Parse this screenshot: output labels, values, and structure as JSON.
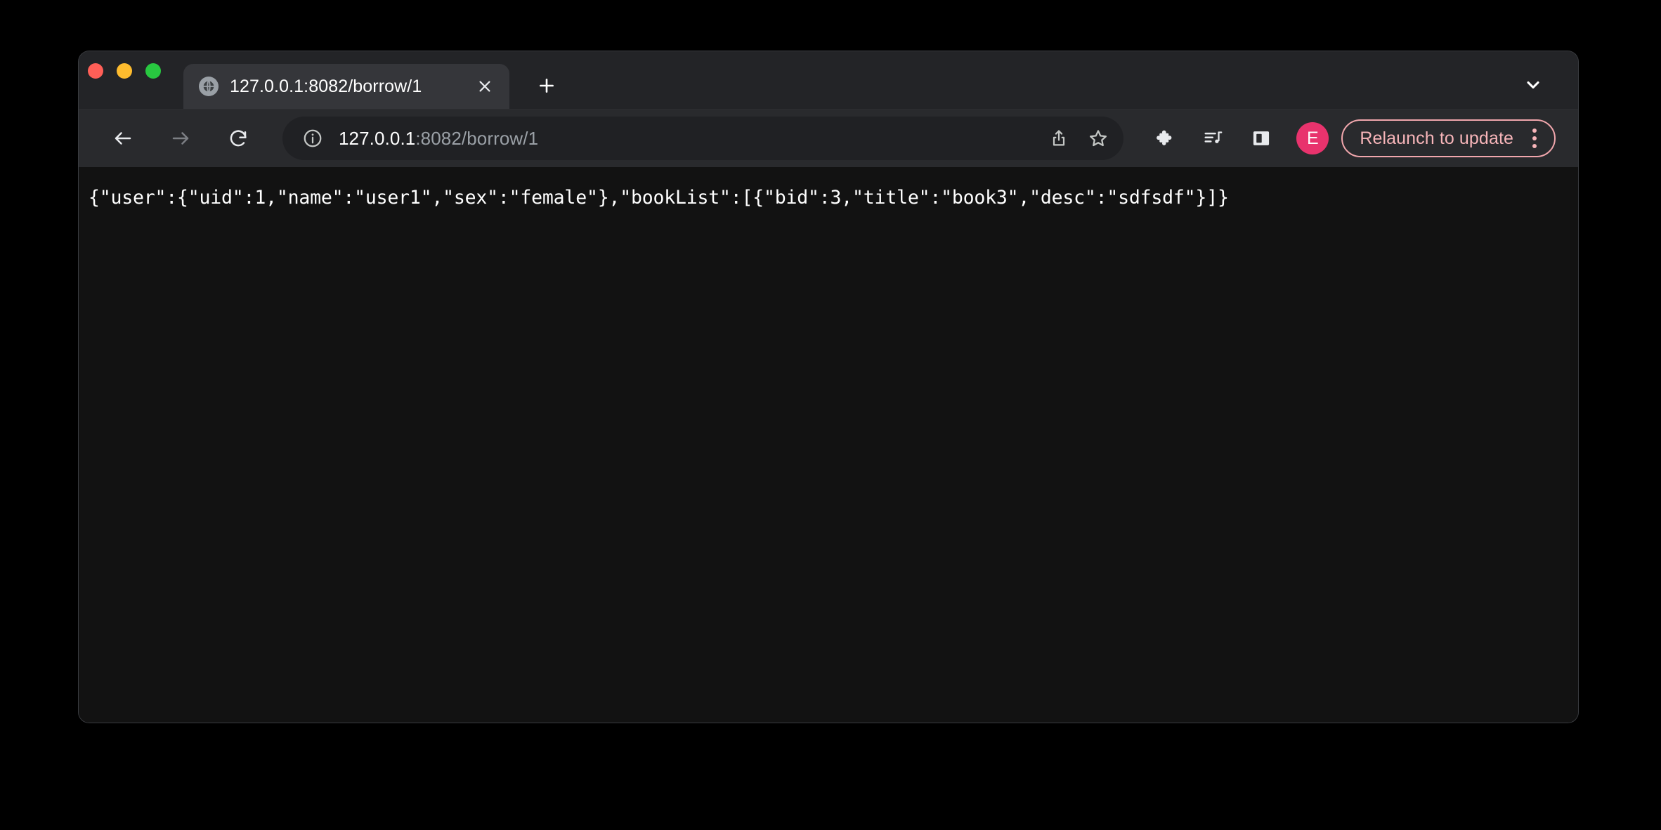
{
  "window": {
    "traffic_lights": [
      {
        "name": "close",
        "color": "#ff5f57"
      },
      {
        "name": "minimize",
        "color": "#febc2e"
      },
      {
        "name": "maximize",
        "color": "#28c840"
      }
    ]
  },
  "tab_strip": {
    "active_tab": {
      "title": "127.0.0.1:8082/borrow/1",
      "favicon": "globe-icon",
      "close_label": "×"
    },
    "new_tab_label": "+",
    "tab_search": "chevron-down-icon"
  },
  "toolbar": {
    "back": "back-arrow-icon",
    "forward": "forward-arrow-icon",
    "reload": "reload-icon",
    "omnibox": {
      "site_info": "info-circle-icon",
      "url_host": "127.0.0.1",
      "url_path": ":8082/borrow/1",
      "share": "share-icon",
      "bookmark": "star-icon"
    },
    "extensions": "puzzle-piece-icon",
    "media": "media-music-list-icon",
    "side_panel": "side-panel-icon",
    "profile": {
      "initial": "E",
      "color": "#e8336d"
    },
    "relaunch": {
      "label": "Relaunch to update",
      "menu": "three-dots-vertical-icon",
      "accent": "#f0a6ac"
    }
  },
  "page": {
    "body_text": "{\"user\":{\"uid\":1,\"name\":\"user1\",\"sex\":\"female\"},\"bookList\":[{\"bid\":3,\"title\":\"book3\",\"desc\":\"sdfsdf\"}]}"
  }
}
